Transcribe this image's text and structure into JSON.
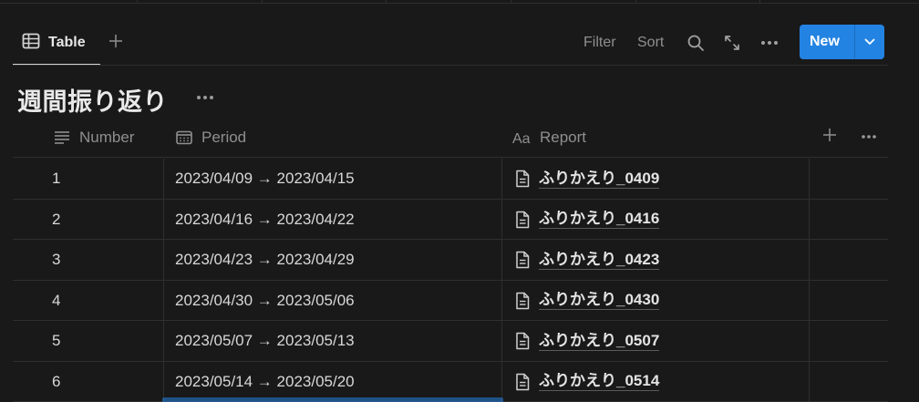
{
  "view": {
    "tab_label": "Table"
  },
  "toolbar": {
    "filter_label": "Filter",
    "sort_label": "Sort",
    "new_label": "New"
  },
  "database": {
    "title": "週間振り返り"
  },
  "columns": {
    "number": "Number",
    "period": "Period",
    "report": "Report"
  },
  "rows": [
    {
      "number": "1",
      "period": "2023/04/09 → 2023/04/15",
      "report": "ふりかえり_0409"
    },
    {
      "number": "2",
      "period": "2023/04/16 → 2023/04/22",
      "report": "ふりかえり_0416"
    },
    {
      "number": "3",
      "period": "2023/04/23 → 2023/04/29",
      "report": "ふりかえり_0423"
    },
    {
      "number": "4",
      "period": "2023/04/30 → 2023/05/06",
      "report": "ふりかえり_0430"
    },
    {
      "number": "5",
      "period": "2023/05/07 → 2023/05/13",
      "report": "ふりかえり_0507"
    },
    {
      "number": "6",
      "period": "2023/05/14 → 2023/05/20",
      "report": "ふりかえり_0514"
    }
  ],
  "colors": {
    "accent": "#2383e2",
    "background": "#191919",
    "border": "#2f2f2f"
  }
}
